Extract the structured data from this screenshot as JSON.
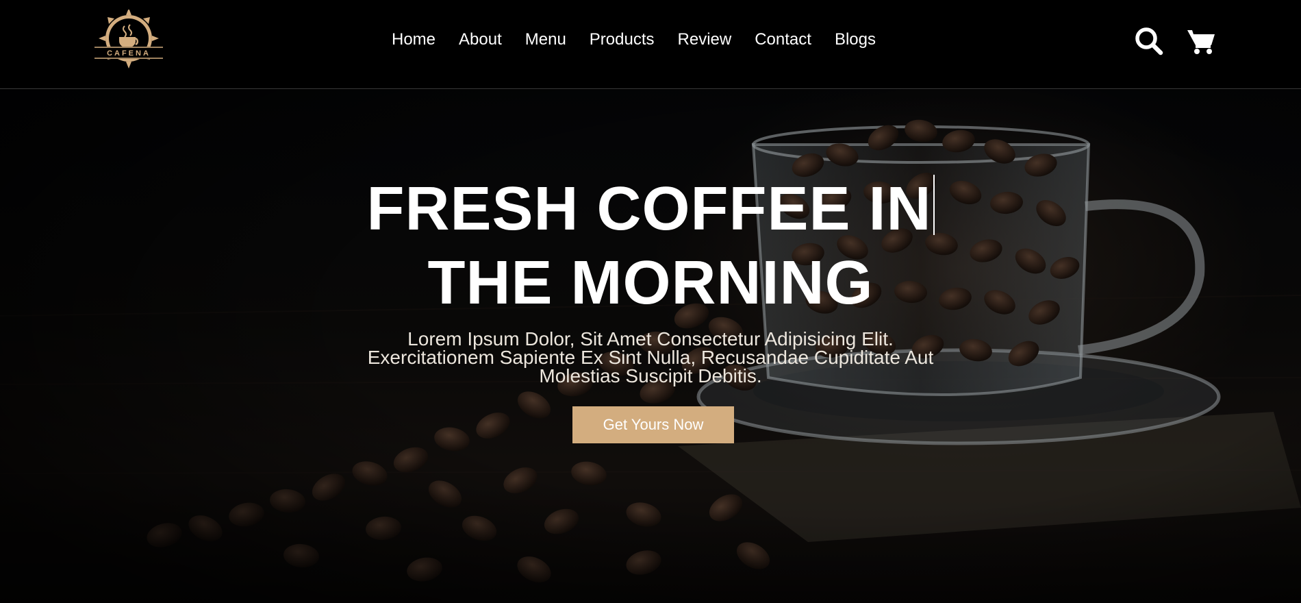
{
  "header": {
    "logo_text": "CAFENA",
    "nav": [
      {
        "label": "Home"
      },
      {
        "label": "About"
      },
      {
        "label": "Menu"
      },
      {
        "label": "Products"
      },
      {
        "label": "Review"
      },
      {
        "label": "Contact"
      },
      {
        "label": "Blogs"
      }
    ],
    "icons": [
      "search-icon",
      "cart-icon"
    ]
  },
  "hero": {
    "title_line1": "FRESH COFFEE IN",
    "title_line2": "THE MORNING",
    "subtitle_line1": "Lorem Ipsum Dolor, Sit Amet Consectetur Adipisicing Elit.",
    "subtitle_line2": "Exercitationem Sapiente Ex Sint Nulla, Recusandae Cupiditate Aut",
    "subtitle_line3": "Molestias Suscipit Debitis.",
    "cta_label": "Get Yours Now",
    "background": "coffee beans in glass cup on saucer"
  },
  "colors": {
    "accent": "#d3ad7f",
    "header_bg": "#000000",
    "text": "#ffffff"
  }
}
